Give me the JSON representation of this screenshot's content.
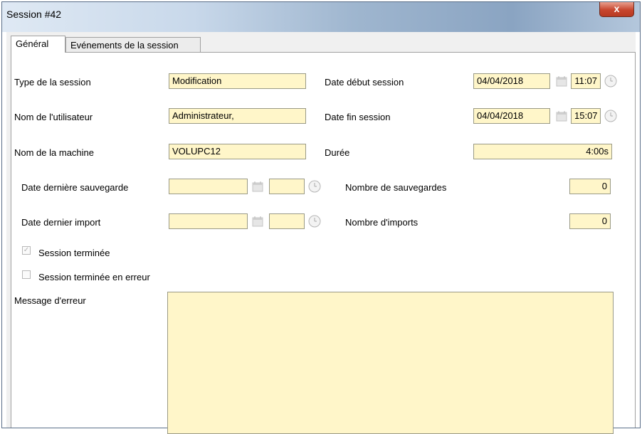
{
  "window": {
    "title": "Session #42",
    "close_label": "x"
  },
  "tabs": [
    {
      "label": "Général"
    },
    {
      "label": "Evénements de la session"
    }
  ],
  "general": {
    "type_label": "Type de la session",
    "type_value": "Modification",
    "user_label": "Nom de l'utilisateur",
    "user_value": "Administrateur,",
    "machine_label": "Nom de la machine",
    "machine_value": "VOLUPC12",
    "last_save_label": "Date dernière sauvegarde",
    "last_save_date": "",
    "last_save_time": "",
    "last_import_label": "Date dernier import",
    "last_import_date": "",
    "last_import_time": "",
    "start_label": "Date début session",
    "start_date": "04/04/2018",
    "start_time": "11:07",
    "end_label": "Date fin session",
    "end_date": "04/04/2018",
    "end_time": "15:07",
    "duration_label": "Durée",
    "duration_value": "4:00s",
    "save_count_label": "Nombre de sauvegardes",
    "save_count_value": "0",
    "import_count_label": "Nombre d'imports",
    "import_count_value": "0",
    "session_done_label": "Session terminée",
    "session_done_checked": true,
    "session_error_label": "Session terminée en erreur",
    "session_error_checked": false,
    "error_message_label": "Message d'erreur",
    "error_message_value": ""
  },
  "colors": {
    "field_bg": "#fff6c9",
    "close_button": "#c7462e"
  }
}
